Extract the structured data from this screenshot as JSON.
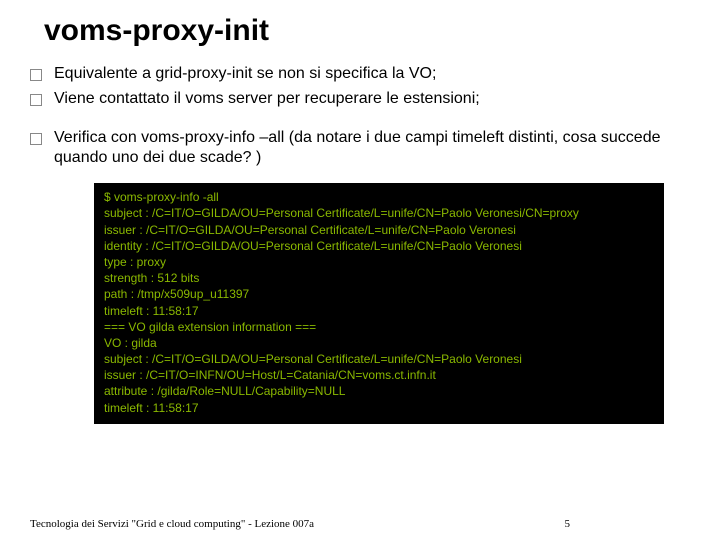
{
  "title": "voms-proxy-init",
  "bullets": [
    "Equivalente a grid-proxy-init se non si specifica la VO;",
    "Viene contattato il voms server per recuperare le estensioni;"
  ],
  "bullet3": "Verifica con voms-proxy-info –all (da notare i due campi timeleft distinti, cosa succede quando uno dei due scade? )",
  "code": [
    "$ voms-proxy-info -all",
    "subject    : /C=IT/O=GILDA/OU=Personal Certificate/L=unife/CN=Paolo Veronesi/CN=proxy",
    "issuer     : /C=IT/O=GILDA/OU=Personal Certificate/L=unife/CN=Paolo Veronesi",
    "identity   : /C=IT/O=GILDA/OU=Personal Certificate/L=unife/CN=Paolo Veronesi",
    "type       : proxy",
    "strength  : 512 bits",
    "path       : /tmp/x509up_u11397",
    "timeleft   : 11:58:17",
    "=== VO gilda extension information ===",
    "VO           : gilda",
    "subject    : /C=IT/O=GILDA/OU=Personal Certificate/L=unife/CN=Paolo Veronesi",
    "issuer     : /C=IT/O=INFN/OU=Host/L=Catania/CN=voms.ct.infn.it",
    "attribute : /gilda/Role=NULL/Capability=NULL",
    "timeleft   : 11:58:17"
  ],
  "footer_left": "Tecnologia dei Servizi \"Grid e cloud computing\" - Lezione 007a",
  "footer_right": "5"
}
